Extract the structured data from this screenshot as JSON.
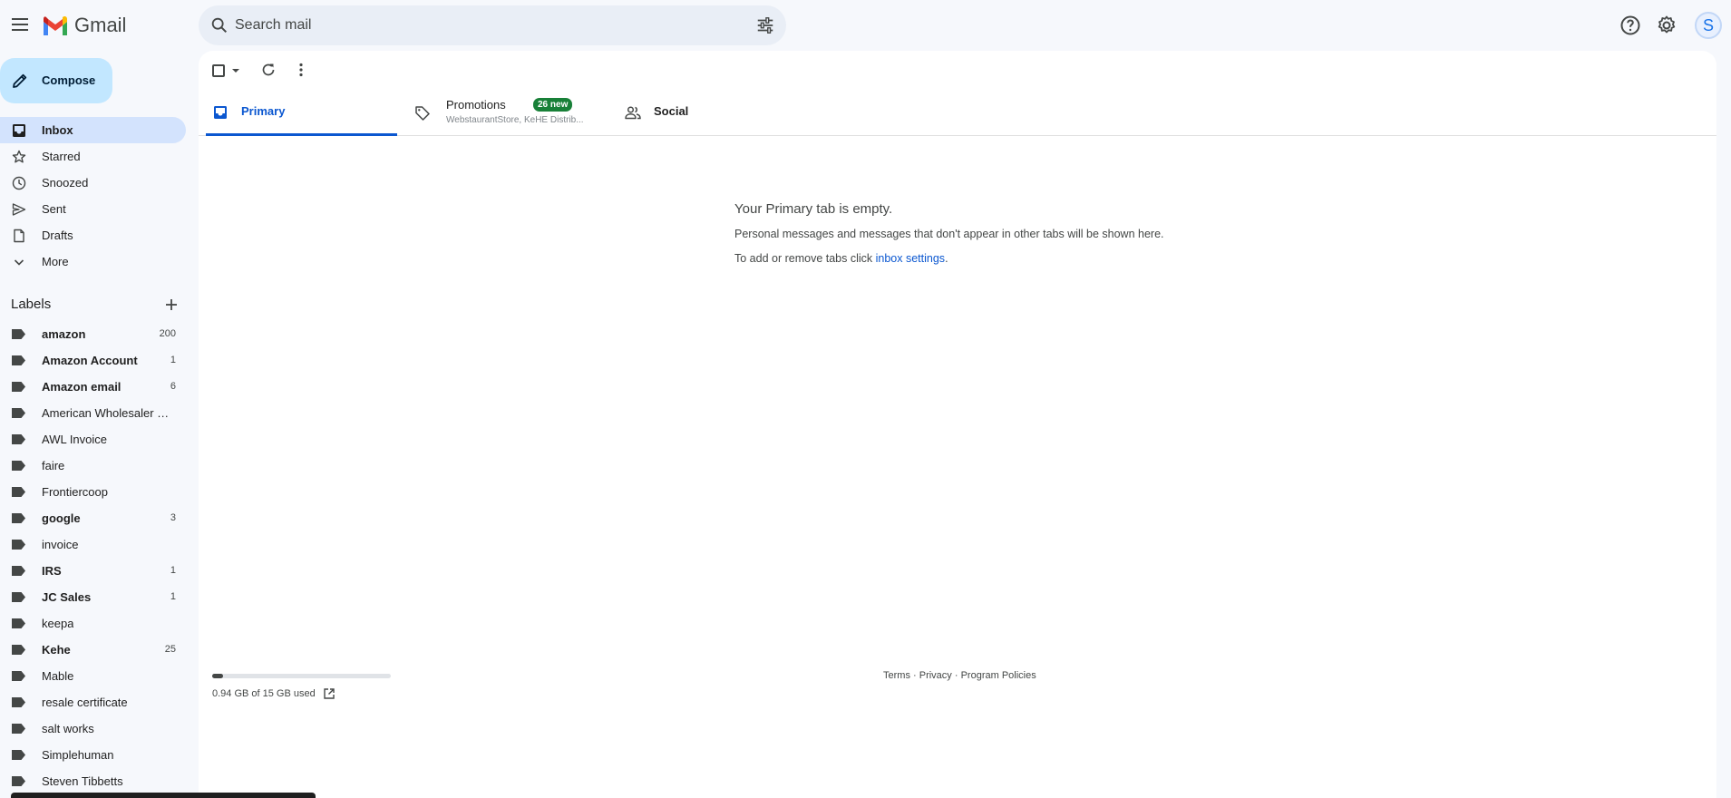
{
  "app": {
    "name": "Gmail"
  },
  "search": {
    "placeholder": "Search mail"
  },
  "account": {
    "initial": "S"
  },
  "compose": {
    "label": "Compose"
  },
  "nav": [
    {
      "label": "Inbox",
      "icon": "inbox-icon"
    },
    {
      "label": "Starred",
      "icon": "star-icon"
    },
    {
      "label": "Snoozed",
      "icon": "clock-icon"
    },
    {
      "label": "Sent",
      "icon": "send-icon"
    },
    {
      "label": "Drafts",
      "icon": "draft-icon"
    },
    {
      "label": "More",
      "icon": "chevron-down-icon"
    }
  ],
  "labels": {
    "title": "Labels",
    "items": [
      {
        "label": "amazon",
        "count": "200"
      },
      {
        "label": "Amazon Account",
        "count": "1"
      },
      {
        "label": "Amazon email",
        "count": "6"
      },
      {
        "label": "American Wholesaler S...",
        "count": ""
      },
      {
        "label": "AWL Invoice",
        "count": ""
      },
      {
        "label": "faire",
        "count": ""
      },
      {
        "label": "Frontiercoop",
        "count": ""
      },
      {
        "label": "google",
        "count": "3"
      },
      {
        "label": "invoice",
        "count": ""
      },
      {
        "label": "IRS",
        "count": "1"
      },
      {
        "label": "JC Sales",
        "count": "1"
      },
      {
        "label": "keepa",
        "count": ""
      },
      {
        "label": "Kehe",
        "count": "25"
      },
      {
        "label": "Mable",
        "count": ""
      },
      {
        "label": "resale certificate",
        "count": ""
      },
      {
        "label": "salt works",
        "count": ""
      },
      {
        "label": "Simplehuman",
        "count": ""
      },
      {
        "label": "Steven Tibbetts",
        "count": ""
      }
    ]
  },
  "tabs": {
    "primary": {
      "label": "Primary"
    },
    "promotions": {
      "label": "Promotions",
      "badge": "26 new",
      "senders": "WebstaurantStore, KeHE Distrib..."
    },
    "social": {
      "label": "Social"
    }
  },
  "empty_state": {
    "title": "Your Primary tab is empty.",
    "description": "Personal messages and messages that don't appear in other tabs will be shown here.",
    "tip_prefix": "To add or remove tabs click ",
    "tip_link": "inbox settings",
    "tip_suffix": "."
  },
  "storage": {
    "used_text": "0.94 GB of 15 GB used",
    "fraction_used": 0.063
  },
  "footer": {
    "terms": "Terms",
    "separator": " · ",
    "privacy": "Privacy",
    "policies": "Program Policies"
  },
  "colors": {
    "accent": "#0b57d0",
    "active_nav": "#d3e3fd",
    "compose_bg": "#c2e7ff",
    "promo_badge": "#188038",
    "page_bg": "#f6f8fc"
  }
}
